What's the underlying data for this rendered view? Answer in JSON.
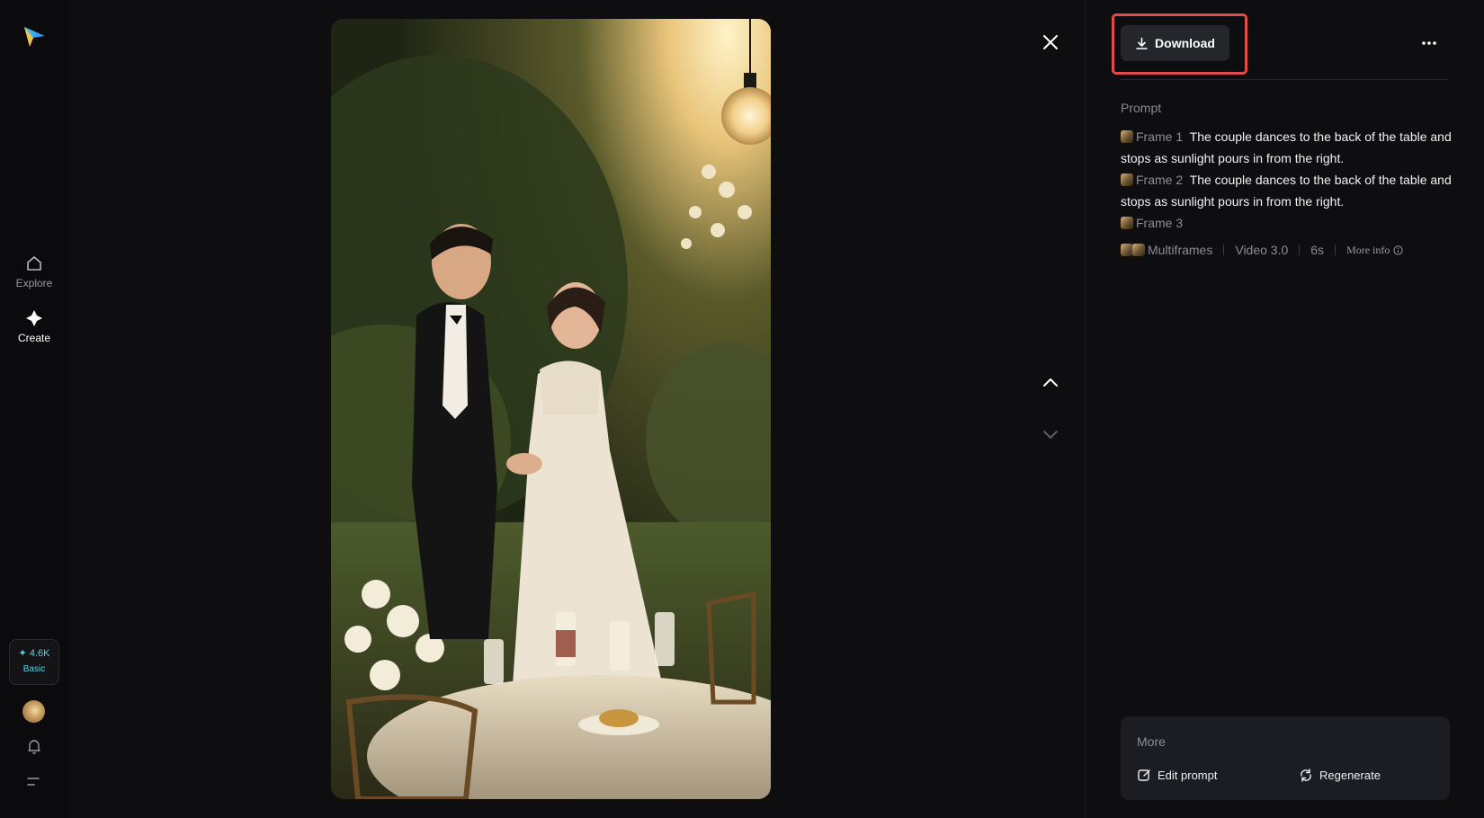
{
  "sidebar": {
    "logo": "paper-plane-logo",
    "nav": [
      {
        "label": "Explore",
        "icon": "home-icon",
        "active": false
      },
      {
        "label": "Create",
        "icon": "sparkle-icon",
        "active": true
      }
    ],
    "credits": {
      "amount": "✦ 4.6K",
      "plan": "Basic"
    },
    "bottom_icons": [
      "avatar",
      "bell-icon",
      "menu-icon"
    ]
  },
  "viewer": {
    "media_description_icon": "wedding-couple-image",
    "controls": [
      "close-icon",
      "chevron-up-icon",
      "chevron-down-icon"
    ]
  },
  "panel": {
    "download_label": "Download",
    "prompt_label": "Prompt",
    "frames": [
      {
        "tag": "Frame 1",
        "text": "The couple dances to the back of the table and stops as sunlight pours in from the right."
      },
      {
        "tag": "Frame 2",
        "text": "The couple dances to the back of the table and stops as sunlight pours in from the right."
      },
      {
        "tag": "Frame 3",
        "text": ""
      }
    ],
    "meta": {
      "mode": "Multiframes",
      "model": "Video 3.0",
      "duration": "6s",
      "more_info": "More info"
    },
    "more": {
      "title": "More",
      "edit_prompt": "Edit prompt",
      "regenerate": "Regenerate"
    }
  },
  "colors": {
    "background": "#0e0e10",
    "accent_credit": "#4fd6e6",
    "highlight": "#e24b4b",
    "button": "#25262b"
  }
}
